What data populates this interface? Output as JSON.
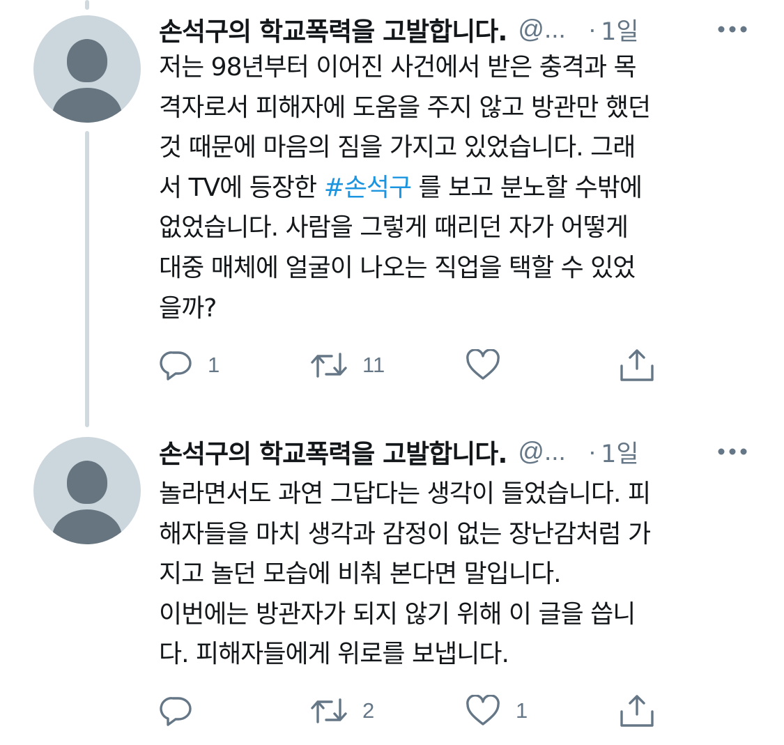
{
  "tweets": [
    {
      "display_name": "손석구의 학교폭력을 고발합니다.",
      "handle": "@...",
      "dot": "·",
      "time": "1일",
      "text_before_hashtag": "저는 98년부터 이어진 사건에서 받은 충격과 목\n격자로서 피해자에 도움을 주지 않고 방관만 했던\n것 때문에 마음의 짐을 가지고 있었습니다. 그래\n서 TV에 등장한 ",
      "hashtag": "#손석구",
      "text_after_hashtag": " 를 보고 분노할 수밖에\n없었습니다. 사람을 그렇게 때리던 자가 어떻게\n대중 매체에 얼굴이 나오는 직업을 택할 수 있었\n을까?",
      "reply_count": "1",
      "retweet_count": "11",
      "like_count": ""
    },
    {
      "display_name": "손석구의 학교폭력을 고발합니다.",
      "handle": "@...",
      "dot": "·",
      "time": "1일",
      "text": "놀라면서도 과연 그답다는 생각이 들었습니다. 피\n해자들을 마치 생각과 감정이 없는 장난감처럼 가\n지고 놀던 모습에 비춰 본다면 말입니다.\n이번에는 방관자가 되지 않기 위해 이 글을 씁니\n다. 피해자들에게 위로를 보냅니다.",
      "reply_count": "",
      "retweet_count": "2",
      "like_count": "1"
    }
  ],
  "colors": {
    "text": "#14171a",
    "secondary": "#657786",
    "hashtag": "#1b95e0",
    "avatar_bg": "#ccd6dd",
    "avatar_fg": "#66757f",
    "thread_line": "#cfd9de"
  },
  "icons": {
    "reply": "reply-icon",
    "retweet": "retweet-icon",
    "like": "heart-icon",
    "share": "share-icon",
    "more": "more-icon"
  }
}
